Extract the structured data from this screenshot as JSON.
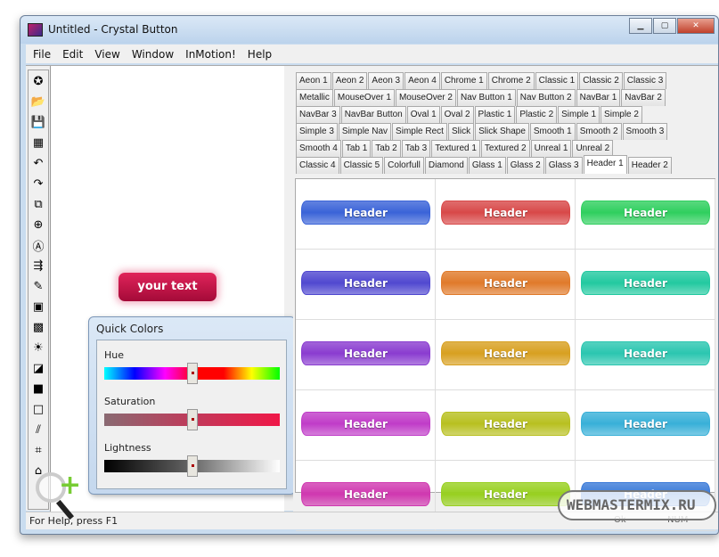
{
  "window": {
    "title": "Untitled - Crystal Button",
    "controls": [
      "minimize",
      "maximize",
      "close"
    ]
  },
  "menu": [
    "File",
    "Edit",
    "View",
    "Window",
    "InMotion!",
    "Help"
  ],
  "toolbar": [
    "new-icon",
    "open-icon",
    "save-icon",
    "export-icon",
    "undo-icon",
    "redo-icon",
    "copy-icon",
    "zoom-in-icon",
    "zoom-fit-icon",
    "preview-icon",
    "pencil-icon",
    "image-icon",
    "texture-icon",
    "light-icon",
    "eraser-icon",
    "shape-icon",
    "rectangle-icon",
    "chart-icon",
    "crop-icon",
    "home-icon"
  ],
  "canvas": {
    "button_text": "your text",
    "button_color": "#c8164a"
  },
  "quick_colors": {
    "title": "Quick Colors",
    "hue_label": "Hue",
    "saturation_label": "Saturation",
    "lightness_label": "Lightness",
    "hue": 0.5,
    "saturation": 0.5,
    "lightness": 0.5
  },
  "tabs": [
    [
      "Aeon 1",
      "Aeon 2",
      "Aeon 3",
      "Aeon 4",
      "Chrome 1",
      "Chrome 2",
      "Classic 1",
      "Classic 2",
      "Classic 3"
    ],
    [
      "Metallic",
      "MouseOver 1",
      "MouseOver 2",
      "Nav Button 1",
      "Nav Button 2",
      "NavBar 1",
      "NavBar 2"
    ],
    [
      "NavBar 3",
      "NavBar Button",
      "Oval 1",
      "Oval 2",
      "Plastic 1",
      "Plastic 2",
      "Simple 1",
      "Simple 2"
    ],
    [
      "Simple 3",
      "Simple Nav",
      "Simple Rect",
      "Slick",
      "Slick Shape",
      "Smooth 1",
      "Smooth 2",
      "Smooth 3"
    ],
    [
      "Smooth 4",
      "Tab 1",
      "Tab 2",
      "Tab 3",
      "Textured 1",
      "Textured 2",
      "Unreal 1",
      "Unreal 2"
    ],
    [
      "Classic 4",
      "Classic 5",
      "Colorfull",
      "Diamond",
      "Glass 1",
      "Glass 2",
      "Glass 3",
      "Header 1",
      "Header 2"
    ]
  ],
  "selected_tab": "Header 1",
  "preset_label": "Header",
  "preset_colors": [
    "#3a63d8",
    "#d84848",
    "#2fcf5e",
    "#5048d0",
    "#e07a2a",
    "#22c9a0",
    "#8a3cd0",
    "#d8a020",
    "#2ac6b0",
    "#c03cc8",
    "#b8c020",
    "#38b0d8",
    "#d038b0",
    "#98d020",
    "#3a7ad8"
  ],
  "status": {
    "help": "For Help, press F1",
    "indicators": [
      "Ok",
      "NUM"
    ]
  },
  "watermark": "WEBMASTERMIX.RU"
}
